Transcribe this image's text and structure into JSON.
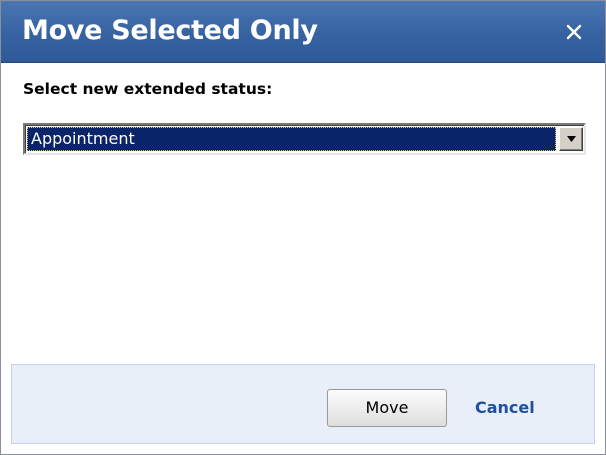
{
  "dialog": {
    "title": "Move Selected Only",
    "close_icon": "close-x-icon"
  },
  "form": {
    "prompt": "Select new extended status:",
    "status_select": {
      "selected_value": "Appointment",
      "arrow_icon": "chevron-down-icon"
    }
  },
  "footer": {
    "move_label": "Move",
    "cancel_label": "Cancel"
  },
  "colors": {
    "titlebar": "#3662a2",
    "selection": "#0a246a",
    "footer_bg": "#e9eff8",
    "link": "#1f4f9e"
  }
}
